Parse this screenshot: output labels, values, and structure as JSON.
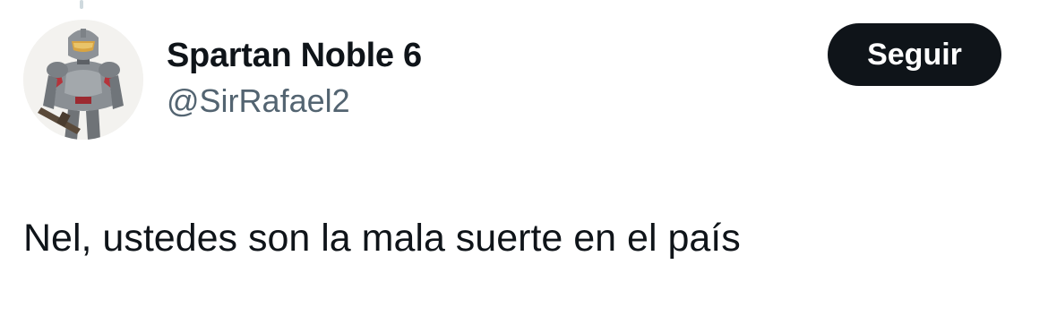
{
  "tweet": {
    "author": {
      "display_name": "Spartan Noble 6",
      "handle": "@SirRafael2",
      "avatar_icon": "spartan-armor-avatar"
    },
    "follow_button_label": "Seguir",
    "text": "Nel, ustedes son la mala suerte en el país"
  },
  "colors": {
    "text_primary": "#0f1419",
    "text_secondary": "#536471",
    "button_bg": "#0f1419",
    "button_text": "#ffffff",
    "thread_line": "#cfd9de"
  }
}
